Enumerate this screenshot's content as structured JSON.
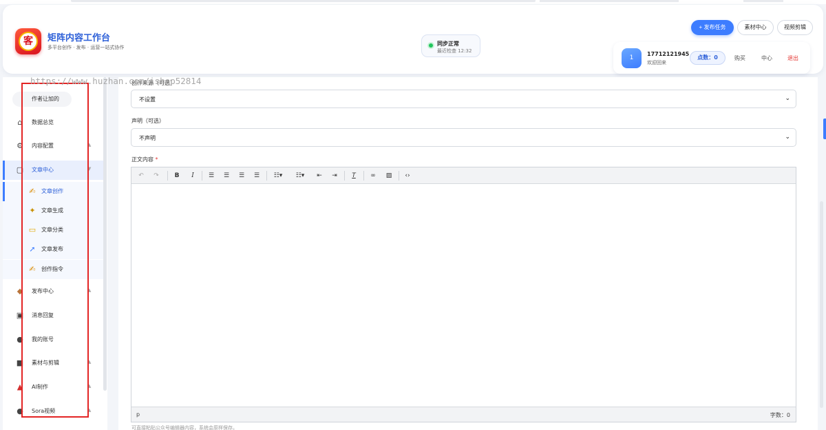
{
  "header": {
    "logo_char": "客",
    "title": "矩阵内容工作台",
    "subtitle": "多平台创作 · 发布 · 运营一站式协作",
    "sync_title": "同步正常",
    "sync_time": "最近检查 12:32",
    "publish_button": "+ 发布任务",
    "material_button": "素材中心",
    "video_button": "视频剪辑"
  },
  "user": {
    "avatar_text": "1",
    "phone": "17712121945",
    "welcome": "欢迎回来",
    "points": "点数：0",
    "buy": "购买",
    "center": "中心",
    "logout": "退出"
  },
  "sidebar": {
    "top_pill": "作者让加的",
    "items": [
      {
        "label": "数据总览",
        "icon": "home-icon"
      },
      {
        "label": "内容配置",
        "icon": "settings-icon"
      },
      {
        "label": "文章中心",
        "icon": "document-icon"
      },
      {
        "label": "文章创作",
        "icon": "pen-icon"
      },
      {
        "label": "文章生成",
        "icon": "sparkle-icon"
      },
      {
        "label": "文章分类",
        "icon": "folder-icon"
      },
      {
        "label": "文章发布",
        "icon": "rocket-icon"
      },
      {
        "label": "创作指令",
        "icon": "pen-icon"
      },
      {
        "label": "发布中心",
        "icon": "shield-icon"
      },
      {
        "label": "消息回复",
        "icon": "chat-icon"
      },
      {
        "label": "我的账号",
        "icon": "user-icon"
      },
      {
        "label": "素材与剪辑",
        "icon": "film-icon"
      },
      {
        "label": "AI制作",
        "icon": "ai-icon"
      },
      {
        "label": "Sora视频",
        "icon": "video-icon"
      }
    ]
  },
  "watermark": "https://www.huzhan.com/ishop52814",
  "form": {
    "field1_label": "创作来源（可选）",
    "field1_value": "不设置",
    "field2_label": "声明（可选）",
    "field2_value": "不声明",
    "content_label": "正文内容",
    "required_mark": "*",
    "status_path": "p",
    "word_count": "字数：0",
    "hint": "可直接粘贴公众号编辑器内容，系统会原样保存。"
  },
  "colors": {
    "accent": "#3d7dff",
    "brand_title": "#2c5fd8",
    "danger": "#e53935",
    "ok": "#22c55e"
  }
}
